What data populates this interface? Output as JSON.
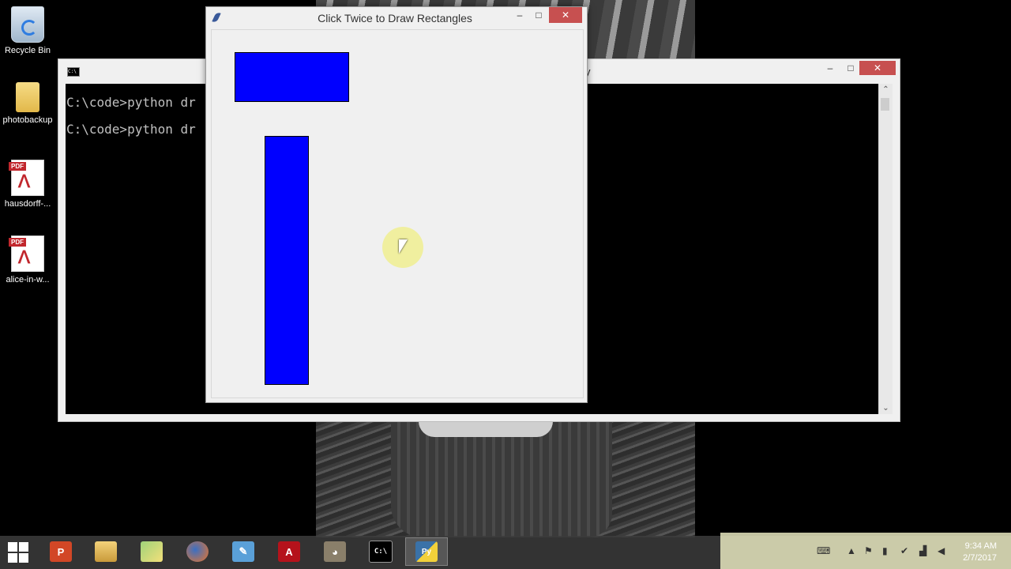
{
  "desktop": {
    "icons": [
      {
        "label": "Recycle Bin",
        "icon": "recycle-bin-icon"
      },
      {
        "label": "photobackup",
        "icon": "folder-icon"
      },
      {
        "label": "hausdorff-...",
        "icon": "pdf-file-icon",
        "tag": "PDF"
      },
      {
        "label": "alice-in-w...",
        "icon": "pdf-file-icon",
        "tag": "PDF"
      }
    ]
  },
  "console_window": {
    "title_partial": "y",
    "lines": [
      "C:\\code>python dr",
      "C:\\code>python dr"
    ],
    "buttons": {
      "minimize": "–",
      "maximize": "□",
      "close": "✕"
    }
  },
  "tk_window": {
    "title": "Click Twice to Draw Rectangles",
    "buttons": {
      "minimize": "–",
      "maximize": "□",
      "close": "✕"
    },
    "rectangles_color": "#0000ff"
  },
  "taskbar": {
    "apps": [
      {
        "name": "powerpoint-icon",
        "glyph": "P"
      },
      {
        "name": "file-explorer-icon",
        "glyph": ""
      },
      {
        "name": "folder-icon",
        "glyph": ""
      },
      {
        "name": "firefox-icon",
        "glyph": ""
      },
      {
        "name": "notepad-icon",
        "glyph": "✎"
      },
      {
        "name": "acrobat-icon",
        "glyph": "A"
      },
      {
        "name": "gimp-icon",
        "glyph": "◕"
      },
      {
        "name": "cmd-icon",
        "glyph": "C:\\"
      },
      {
        "name": "python-icon",
        "glyph": "Py"
      }
    ],
    "clock_time": "9:34 AM",
    "clock_date": "2/7/2017"
  }
}
